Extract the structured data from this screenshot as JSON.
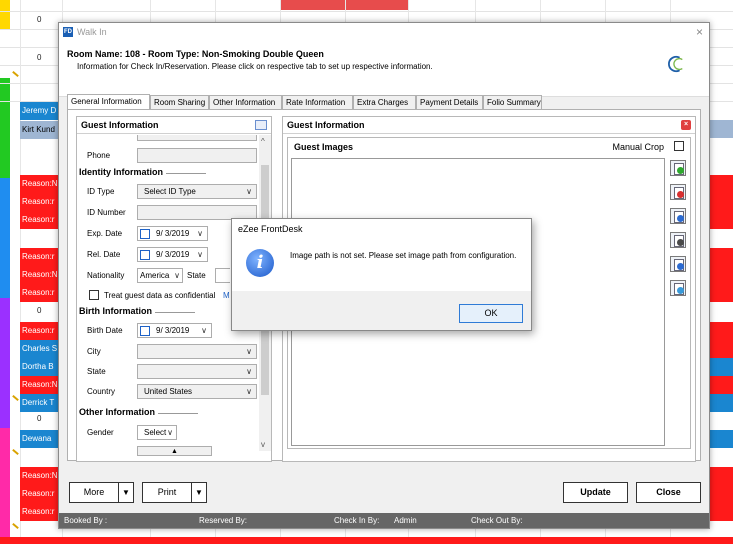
{
  "background": {
    "left_cells": [
      "Jeremy D",
      "Kirt Kund",
      "Reason:N",
      "Reason:r",
      "Reason:r",
      "Reason:r",
      "Reason:N",
      "Reason:r",
      "Reason:r",
      "Charles S",
      "Dortha B",
      "Reason:N",
      "Derrick T",
      "Dewana",
      "Reason:N",
      "Reason:r",
      "Reason:r"
    ],
    "zero": "0",
    "colors": {
      "red": "#ff1a1a",
      "blue": "#1a86d0",
      "grey_blue": "#9fb6d3"
    }
  },
  "window": {
    "title": "Walk In",
    "app_icon": "FD",
    "close_label": "×",
    "room_name": "Room Name: 108 - Room Type: Non-Smoking Double Queen",
    "info": "Information for Check In/Reservation. Please click on respective tab to set up respective information."
  },
  "tabs": [
    "General Information",
    "Room Sharing",
    "Other Information",
    "Rate Information",
    "Extra Charges",
    "Payment Details",
    "Folio Summary"
  ],
  "left_panel": {
    "title": "Guest Information",
    "phone_label": "Phone",
    "identity_heading": "Identity Information",
    "id_type_label": "ID Type",
    "id_type_value": "Select ID Type",
    "id_number_label": "ID Number",
    "exp_date_label": "Exp. Date",
    "exp_date_value": "9/ 3/2019",
    "rel_date_label": "Rel. Date",
    "rel_date_value": "9/ 3/2019",
    "nationality_label": "Nationality",
    "nationality_value": "America",
    "state_label": "State",
    "confidential_label": "Treat guest data as confidential",
    "confidential_link": "M",
    "birth_heading": "Birth Information",
    "birth_date_label": "Birth Date",
    "birth_date_value": "9/ 3/2019",
    "city_label": "City",
    "state2_label": "State",
    "country_label": "Country",
    "country_value": "United States",
    "other_heading": "Other Information",
    "gender_label": "Gender",
    "gender_value": "Select"
  },
  "right_panel": {
    "title": "Guest Information",
    "images_label": "Guest Images",
    "manual_crop_label": "Manual Crop"
  },
  "footer": {
    "more_label": "More",
    "print_label": "Print",
    "update_label": "Update",
    "close_label": "Close",
    "dropdown_arrow": "▼"
  },
  "status": {
    "booked_by": "Booked By :",
    "reserved_by": "Reserved By:",
    "check_in_by": "Check In By:",
    "check_in_user": "Admin",
    "check_out_by": "Check Out By:"
  },
  "message_box": {
    "title": "eZee FrontDesk",
    "icon": "i",
    "text": "Image path is not set. Please set image path from configuration.",
    "ok_label": "OK"
  }
}
